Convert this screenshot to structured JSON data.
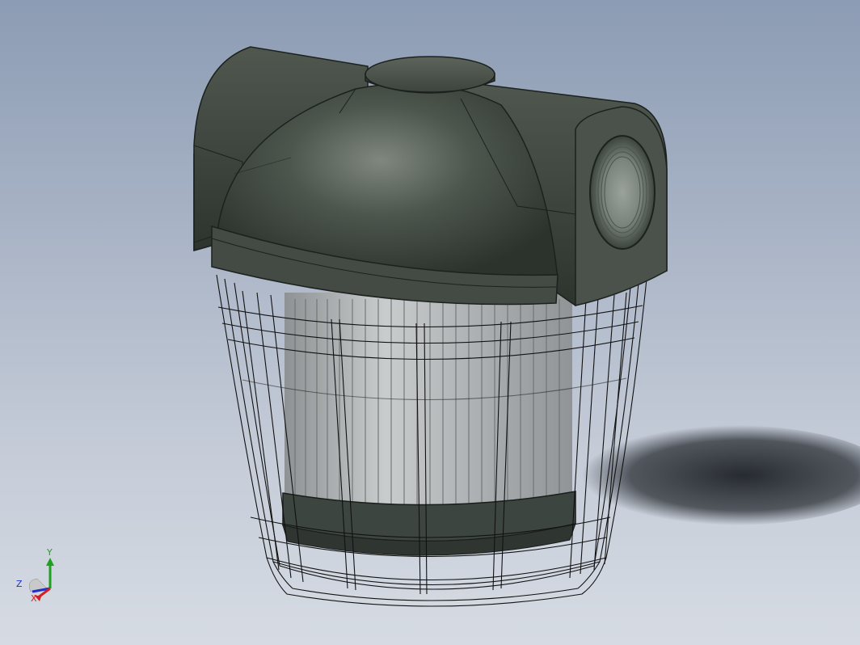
{
  "viewport": {
    "background_top": "#8c9cb4",
    "background_bottom": "#d6dbe3"
  },
  "model": {
    "body_color": "#3f4840",
    "filter_color": "#b9bcbe",
    "wire_color": "#111111",
    "shadow_color": "#2a2e34"
  },
  "triad": {
    "x_label": "X",
    "y_label": "Y",
    "z_label": "Z",
    "x_color": "#d42020",
    "y_color": "#1fa01f",
    "z_color": "#2030c8"
  }
}
